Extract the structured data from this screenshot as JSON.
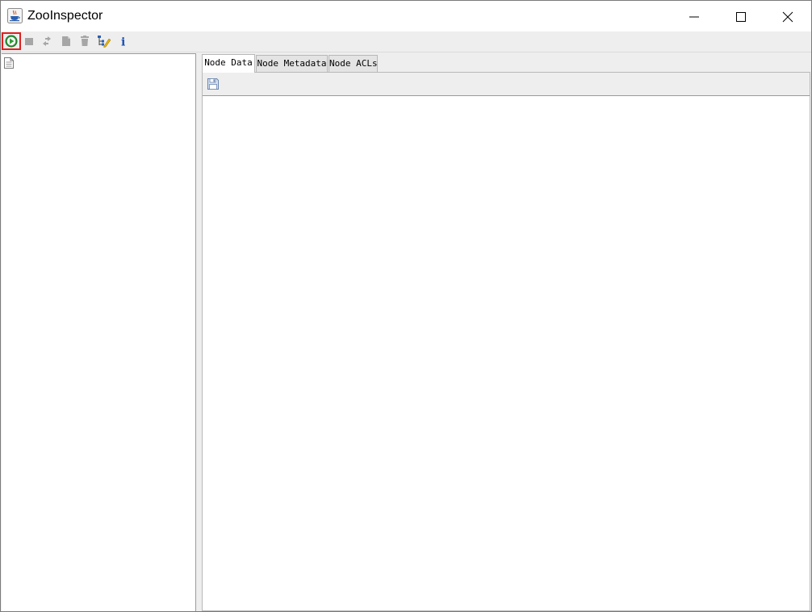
{
  "window": {
    "title": "ZooInspector",
    "icons": {
      "app": "java-cup-icon",
      "minimize": "minimize-icon",
      "maximize": "maximize-icon",
      "close": "close-icon"
    }
  },
  "toolbar": {
    "buttons": [
      {
        "name": "connect",
        "icon": "play-icon"
      },
      {
        "name": "disconnect",
        "icon": "stop-icon"
      },
      {
        "name": "refresh",
        "icon": "refresh-icon"
      },
      {
        "name": "add-node",
        "icon": "add-node-icon"
      },
      {
        "name": "delete-node",
        "icon": "trash-icon"
      },
      {
        "name": "node-viewers",
        "icon": "tree-edit-icon"
      },
      {
        "name": "about",
        "icon": "info-icon"
      }
    ],
    "info_glyph": "i"
  },
  "tree": {
    "root_icon": "document-icon"
  },
  "tabs": [
    {
      "label": "Node Data",
      "selected": true
    },
    {
      "label": "Node Metadata",
      "selected": false
    },
    {
      "label": "Node ACLs",
      "selected": false
    }
  ],
  "node_data": {
    "save_icon": "save-icon",
    "content": ""
  },
  "colors": {
    "highlight": "#e02020",
    "connect_green": "#2e9e3a",
    "info_blue": "#1b4fb5"
  }
}
